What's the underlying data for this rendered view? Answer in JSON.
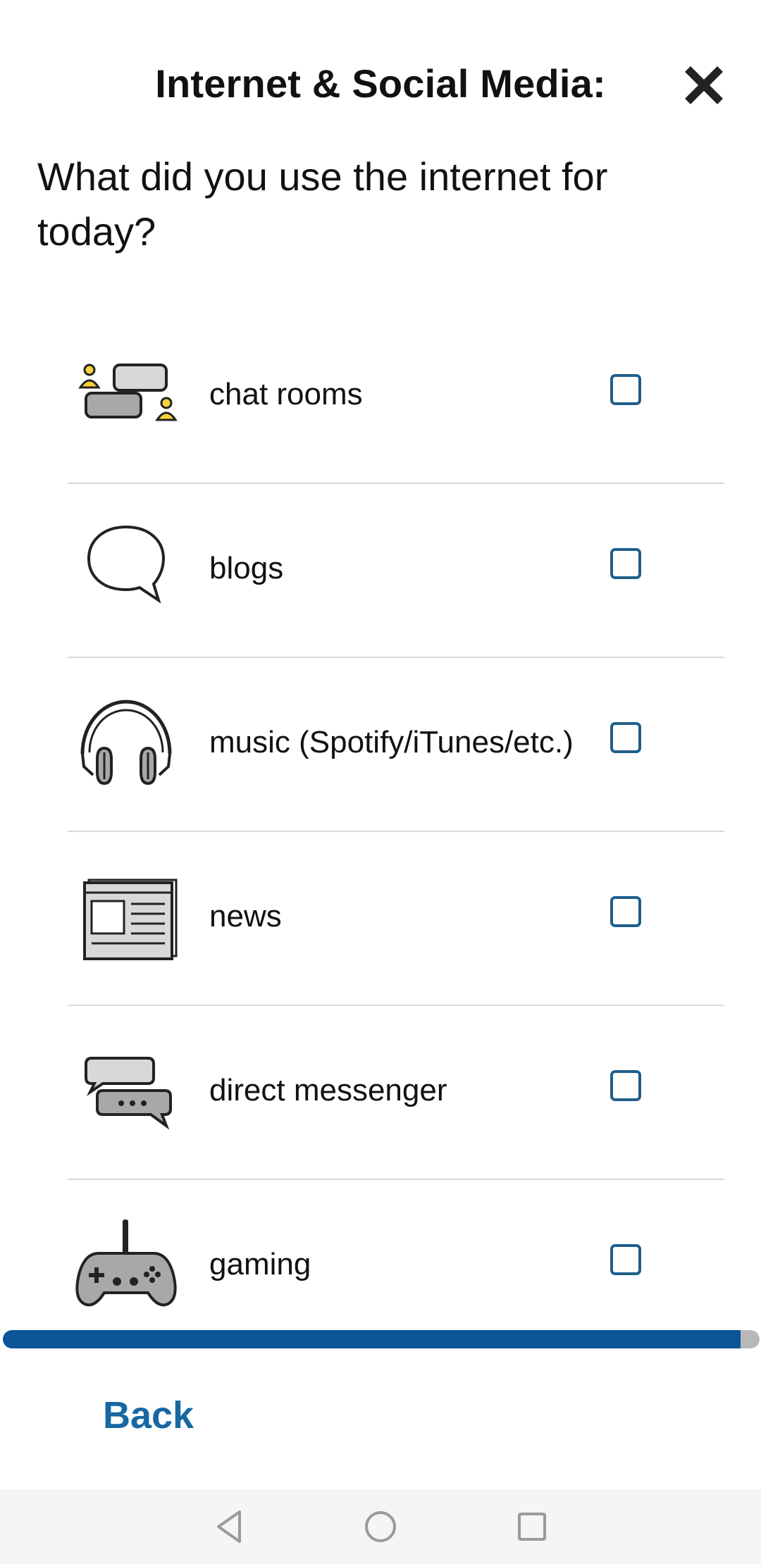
{
  "header": {
    "title": "Internet & Social Media:",
    "close_icon": "close-icon"
  },
  "question": "What did you use the internet for today?",
  "options": [
    {
      "label": "chat rooms",
      "icon": "chat-rooms-icon",
      "checked": false
    },
    {
      "label": "blogs",
      "icon": "speech-bubble-icon",
      "checked": false
    },
    {
      "label": "music (Spotify/iTunes/etc.)",
      "icon": "headphones-icon",
      "checked": false
    },
    {
      "label": "news",
      "icon": "newspaper-icon",
      "checked": false
    },
    {
      "label": "direct messenger",
      "icon": "messenger-icon",
      "checked": false
    },
    {
      "label": "gaming",
      "icon": "game-controller-icon",
      "checked": false
    }
  ],
  "progress": {
    "fraction": 0.975
  },
  "footer": {
    "back_label": "Back"
  },
  "navbar": {
    "items": [
      "back-triangle-icon",
      "home-circle-icon",
      "recents-square-icon"
    ]
  },
  "colors": {
    "accent": "#1767a2",
    "checkbox_border": "#1f5f8b",
    "progress_fill": "#0a5696",
    "progress_track": "#b8b8b8",
    "icon_yellow": "#f5d33c",
    "icon_gray": "#a8a8a8"
  }
}
